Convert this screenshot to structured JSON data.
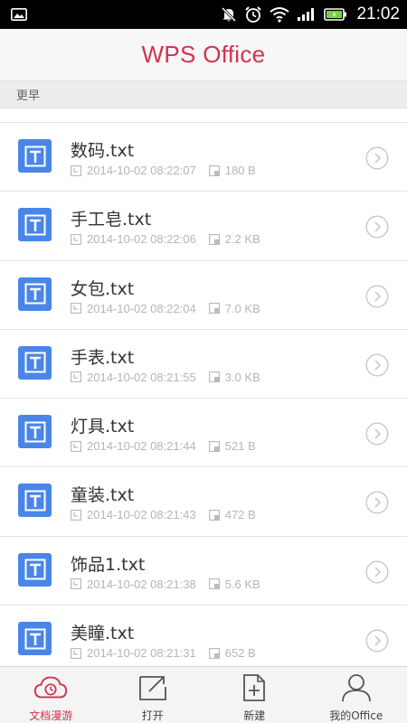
{
  "status_bar": {
    "time": "21:02",
    "icons": [
      "image-icon",
      "mute-icon",
      "alarm-icon",
      "wifi-icon",
      "signal-icon",
      "battery-icon"
    ]
  },
  "header": {
    "title": "WPS Office"
  },
  "section": {
    "label": "更早"
  },
  "files": [
    {
      "name": "数码.txt",
      "date": "2014-10-02 08:22:07",
      "size": "180 B"
    },
    {
      "name": "手工皂.txt",
      "date": "2014-10-02 08:22:06",
      "size": "2.2 KB"
    },
    {
      "name": "女包.txt",
      "date": "2014-10-02 08:22:04",
      "size": "7.0 KB"
    },
    {
      "name": "手表.txt",
      "date": "2014-10-02 08:21:55",
      "size": "3.0 KB"
    },
    {
      "name": "灯具.txt",
      "date": "2014-10-02 08:21:44",
      "size": "521 B"
    },
    {
      "name": "童装.txt",
      "date": "2014-10-02 08:21:43",
      "size": "472 B"
    },
    {
      "name": "饰品1.txt",
      "date": "2014-10-02 08:21:38",
      "size": "5.6 KB"
    },
    {
      "name": "美瞳.txt",
      "date": "2014-10-02 08:21:31",
      "size": "652 B"
    }
  ],
  "bottom_nav": [
    {
      "label": "文档漫游",
      "icon": "cloud-clock-icon",
      "active": true
    },
    {
      "label": "打开",
      "icon": "folder-open-icon",
      "active": false
    },
    {
      "label": "新建",
      "icon": "new-document-icon",
      "active": false
    },
    {
      "label": "我的Office",
      "icon": "user-icon",
      "active": false
    }
  ],
  "colors": {
    "accent": "#d2334e",
    "file_icon": "#4a86e8",
    "meta_text": "#b5b5b5"
  }
}
